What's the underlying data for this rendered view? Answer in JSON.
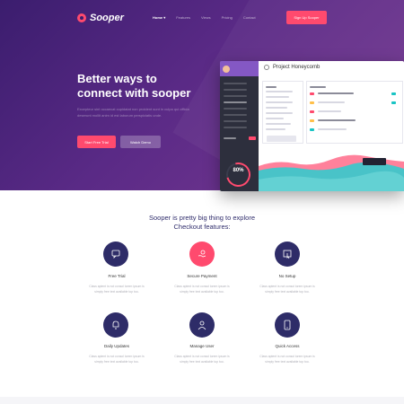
{
  "brand": {
    "name": "Sooper",
    "accent": "#ff4a6e",
    "hero_bg": "#4a2479",
    "icon_bg": "#2e2c68"
  },
  "nav": {
    "items": [
      {
        "label": "Home ▾",
        "active": true
      },
      {
        "label": "Features",
        "active": false
      },
      {
        "label": "Views",
        "active": false
      },
      {
        "label": "Pricing",
        "active": false
      },
      {
        "label": "Contact",
        "active": false
      }
    ],
    "signup_label": "Sign Up Sooper"
  },
  "hero": {
    "headline_line1": "Better ways to",
    "headline_line2": "connect with sooper",
    "subtext": "Excepteur sint occaecat cupidatat non proident sunt in culpa qui officia deserunt mollit anim id est laborum perspiciatis unde.",
    "primary_button": "Start Free Trial",
    "secondary_button": "Watch Demo"
  },
  "dashboard": {
    "project_title": "Project Honeycomb",
    "gauge_value": "80%"
  },
  "features_section": {
    "title_line1": "Sooper is pretty big thing to explore",
    "title_line2": "Checkout features:",
    "items": [
      {
        "title": "Free Trial",
        "icon": "chat-icon",
        "desc": "Class aptent is not consol lorem ipsum is simply free text available top too."
      },
      {
        "title": "Secure Payment",
        "icon": "hand-coin-icon",
        "desc": "Class aptent is not consol lorem ipsum is simply free text available top too."
      },
      {
        "title": "No Setup",
        "icon": "cursor-window-icon",
        "desc": "Class aptent is not consol lorem ipsum is simply free text available top too."
      },
      {
        "title": "Daily Updates",
        "icon": "bell-icon",
        "desc": "Class aptent is not consol lorem ipsum is simply free text available top too."
      },
      {
        "title": "Manage User",
        "icon": "user-icon",
        "desc": "Class aptent is not consol lorem ipsum is simply free text available top too."
      },
      {
        "title": "Quick Access",
        "icon": "phone-touch-icon",
        "desc": "Class aptent is not consol lorem ipsum is simply free text available top too."
      }
    ]
  }
}
